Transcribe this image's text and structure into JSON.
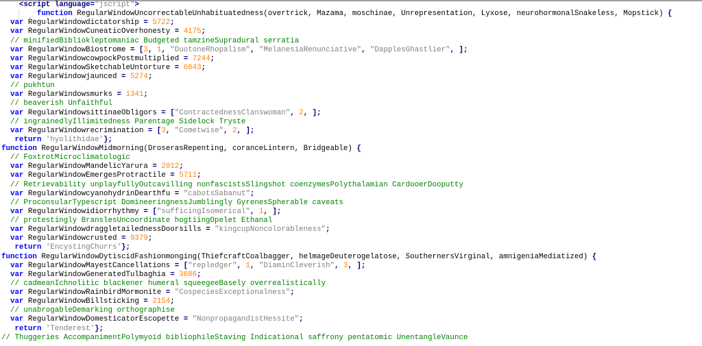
{
  "colors": {
    "keyword": "#0000ff",
    "identifier": "#000000",
    "operator": "#000080",
    "number": "#ff8000",
    "string": "#808080",
    "comment": "#008000"
  },
  "lines": [
    [
      [
        "o",
        "    <script language="
      ],
      [
        "s",
        "\"jscript\""
      ],
      [
        "o",
        ">"
      ]
    ],
    [
      [
        "i",
        "        "
      ],
      [
        "k",
        "function"
      ],
      [
        "i",
        " RegularWindowUncorrectableUnhabituatedness(overtrick, Mazama, moschinae, Unrepresentation, Lyxose, neurohormonalSnakeless, Mopstick) "
      ],
      [
        "o",
        "{"
      ]
    ],
    [
      [
        "i",
        "  "
      ],
      [
        "k",
        "var"
      ],
      [
        "i",
        " RegularWindowdictatorship "
      ],
      [
        "o",
        "= "
      ],
      [
        "n",
        "5722"
      ],
      [
        "o",
        ";"
      ]
    ],
    [
      [
        "i",
        "  "
      ],
      [
        "k",
        "var"
      ],
      [
        "i",
        " RegularWindowCuneaticOverhonesty "
      ],
      [
        "o",
        "= "
      ],
      [
        "n",
        "4175"
      ],
      [
        "o",
        ";"
      ]
    ],
    [
      [
        "c",
        "  // minifiedBibliokleptomaniac Budgeted tamzineSupradural serratia"
      ]
    ],
    [
      [
        "i",
        "  "
      ],
      [
        "k",
        "var"
      ],
      [
        "i",
        " RegularWindowBiostrome "
      ],
      [
        "o",
        "= ["
      ],
      [
        "n",
        "3"
      ],
      [
        "o",
        ", "
      ],
      [
        "n",
        "1"
      ],
      [
        "o",
        ", "
      ],
      [
        "s",
        "\"DuotoneRhopalism\""
      ],
      [
        "o",
        ", "
      ],
      [
        "s",
        "\"MelanesiaRenunciative\""
      ],
      [
        "o",
        ", "
      ],
      [
        "s",
        "\"DapplesGhastlier\""
      ],
      [
        "o",
        ", ];"
      ]
    ],
    [
      [
        "i",
        "  "
      ],
      [
        "k",
        "var"
      ],
      [
        "i",
        " RegularWindowcowpockPostmultiplied "
      ],
      [
        "o",
        "= "
      ],
      [
        "n",
        "7244"
      ],
      [
        "o",
        ";"
      ]
    ],
    [
      [
        "i",
        "  "
      ],
      [
        "k",
        "var"
      ],
      [
        "i",
        " RegularWindowSketchableUntorture "
      ],
      [
        "o",
        "= "
      ],
      [
        "n",
        "6643"
      ],
      [
        "o",
        ";"
      ]
    ],
    [
      [
        "i",
        "  "
      ],
      [
        "k",
        "var"
      ],
      [
        "i",
        " RegularWindowjaunced "
      ],
      [
        "o",
        "= "
      ],
      [
        "n",
        "5274"
      ],
      [
        "o",
        ";"
      ]
    ],
    [
      [
        "c",
        "  // pukhtun"
      ]
    ],
    [
      [
        "i",
        "  "
      ],
      [
        "k",
        "var"
      ],
      [
        "i",
        " RegularWindowsmurks "
      ],
      [
        "o",
        "= "
      ],
      [
        "n",
        "1341"
      ],
      [
        "o",
        ";"
      ]
    ],
    [
      [
        "c",
        "  // beaverish Unfaithful"
      ]
    ],
    [
      [
        "i",
        "  "
      ],
      [
        "k",
        "var"
      ],
      [
        "i",
        " RegularWindowsittinaeObligors "
      ],
      [
        "o",
        "= ["
      ],
      [
        "s",
        "\"ContractednessClanswoman\""
      ],
      [
        "o",
        ", "
      ],
      [
        "n",
        "2"
      ],
      [
        "o",
        ", ];"
      ]
    ],
    [
      [
        "c",
        "  // ingrainedlyIllimitedness Parentage Sidelock Tryste"
      ]
    ],
    [
      [
        "i",
        "  "
      ],
      [
        "k",
        "var"
      ],
      [
        "i",
        " RegularWindowrecrimination "
      ],
      [
        "o",
        "= ["
      ],
      [
        "n",
        "3"
      ],
      [
        "o",
        ", "
      ],
      [
        "s",
        "\"Cometwise\""
      ],
      [
        "o",
        ", "
      ],
      [
        "n",
        "2"
      ],
      [
        "o",
        ", ];"
      ]
    ],
    [
      [
        "i",
        "   "
      ],
      [
        "k",
        "return"
      ],
      [
        "i",
        " "
      ],
      [
        "s",
        "'hyolithidae'"
      ],
      [
        "o",
        "};"
      ]
    ],
    [
      [
        "k",
        "function"
      ],
      [
        "i",
        " RegularWindowMidmorning(DroserasRepenting, coranceLintern, Bridgeable) "
      ],
      [
        "o",
        "{"
      ]
    ],
    [
      [
        "c",
        "  // FoxtrotMicroclimatologic"
      ]
    ],
    [
      [
        "i",
        "  "
      ],
      [
        "k",
        "var"
      ],
      [
        "i",
        " RegularWindowMandelicYarura "
      ],
      [
        "o",
        "= "
      ],
      [
        "n",
        "2012"
      ],
      [
        "o",
        ";"
      ]
    ],
    [
      [
        "i",
        "  "
      ],
      [
        "k",
        "var"
      ],
      [
        "i",
        " RegularWindowEmergesProtractile "
      ],
      [
        "o",
        "= "
      ],
      [
        "n",
        "5711"
      ],
      [
        "o",
        ";"
      ]
    ],
    [
      [
        "c",
        "  // Retrievability unplayfullyOutcavilling nonfascistsSlingshot coenzymesPolythalamian CardooerDooputty"
      ]
    ],
    [
      [
        "i",
        "  "
      ],
      [
        "k",
        "var"
      ],
      [
        "i",
        " RegularWindowcyanohydrinDearthfu "
      ],
      [
        "o",
        "= "
      ],
      [
        "s",
        "\"cabotsSabanut\""
      ],
      [
        "o",
        ";"
      ]
    ],
    [
      [
        "c",
        "  // ProconsularTypescript DomineeringnessJumblingly GyrenesSpherable caveats"
      ]
    ],
    [
      [
        "i",
        "  "
      ],
      [
        "k",
        "var"
      ],
      [
        "i",
        " RegularWindowidiorrhythmy "
      ],
      [
        "o",
        "= ["
      ],
      [
        "s",
        "\"sufficingIsomerical\""
      ],
      [
        "o",
        ", "
      ],
      [
        "n",
        "1"
      ],
      [
        "o",
        ", ];"
      ]
    ],
    [
      [
        "c",
        "  // protestingly BranslesUncoordinate hogtiingOpelet Ethanal"
      ]
    ],
    [
      [
        "i",
        "  "
      ],
      [
        "k",
        "var"
      ],
      [
        "i",
        " RegularWindowdraggletailednessDoorsills "
      ],
      [
        "o",
        "= "
      ],
      [
        "s",
        "\"kingcupNoncolorableness\""
      ],
      [
        "o",
        ";"
      ]
    ],
    [
      [
        "i",
        "  "
      ],
      [
        "k",
        "var"
      ],
      [
        "i",
        " RegularWindowcrusted "
      ],
      [
        "o",
        "= "
      ],
      [
        "n",
        "9379"
      ],
      [
        "o",
        ";"
      ]
    ],
    [
      [
        "i",
        "   "
      ],
      [
        "k",
        "return"
      ],
      [
        "i",
        " "
      ],
      [
        "s",
        "'EncystingChurrs'"
      ],
      [
        "o",
        "};"
      ]
    ],
    [
      [
        "k",
        "function"
      ],
      [
        "i",
        " RegularWindowDytiscidFashionmonging(ThiefcraftCoalbagger, helmageDeuterogelatose, SouthernersVirginal, amnigeniaMediatized) "
      ],
      [
        "o",
        "{"
      ]
    ],
    [
      [
        "i",
        "  "
      ],
      [
        "k",
        "var"
      ],
      [
        "i",
        " RegularWindowMayestCancellations "
      ],
      [
        "o",
        "= ["
      ],
      [
        "s",
        "\"repledger\""
      ],
      [
        "o",
        ", "
      ],
      [
        "n",
        "1"
      ],
      [
        "o",
        ", "
      ],
      [
        "s",
        "\"DiaminCleverish\""
      ],
      [
        "o",
        ", "
      ],
      [
        "n",
        "3"
      ],
      [
        "o",
        ", ];"
      ]
    ],
    [
      [
        "i",
        "  "
      ],
      [
        "k",
        "var"
      ],
      [
        "i",
        " RegularWindowGeneratedTulbaghia "
      ],
      [
        "o",
        "= "
      ],
      [
        "n",
        "3686"
      ],
      [
        "o",
        ";"
      ]
    ],
    [
      [
        "c",
        "  // cadmeanIchnolitic blackener humeral squeegeeBasely overrealistically"
      ]
    ],
    [
      [
        "i",
        "  "
      ],
      [
        "k",
        "var"
      ],
      [
        "i",
        " RegularWindowRainbirdMormonite "
      ],
      [
        "o",
        "= "
      ],
      [
        "s",
        "\"CospeciesExceptionalness\""
      ],
      [
        "o",
        ";"
      ]
    ],
    [
      [
        "i",
        "  "
      ],
      [
        "k",
        "var"
      ],
      [
        "i",
        " RegularWindowBillsticking "
      ],
      [
        "o",
        "= "
      ],
      [
        "n",
        "2154"
      ],
      [
        "o",
        ";"
      ]
    ],
    [
      [
        "c",
        "  // unabrogableDemarking orthographise"
      ]
    ],
    [
      [
        "i",
        "  "
      ],
      [
        "k",
        "var"
      ],
      [
        "i",
        " RegularWindowDomesticatorEscopette "
      ],
      [
        "o",
        "= "
      ],
      [
        "s",
        "\"NonpropagandistHessite\""
      ],
      [
        "o",
        ";"
      ]
    ],
    [
      [
        "i",
        "   "
      ],
      [
        "k",
        "return"
      ],
      [
        "i",
        " "
      ],
      [
        "s",
        "'Tenderest'"
      ],
      [
        "o",
        "};"
      ]
    ],
    [
      [
        "c",
        "// Thuggeries AccompanimentPolymyoid bibliophileStaving Indicational saffrony pentatomic UnentangleVaunce"
      ]
    ]
  ]
}
